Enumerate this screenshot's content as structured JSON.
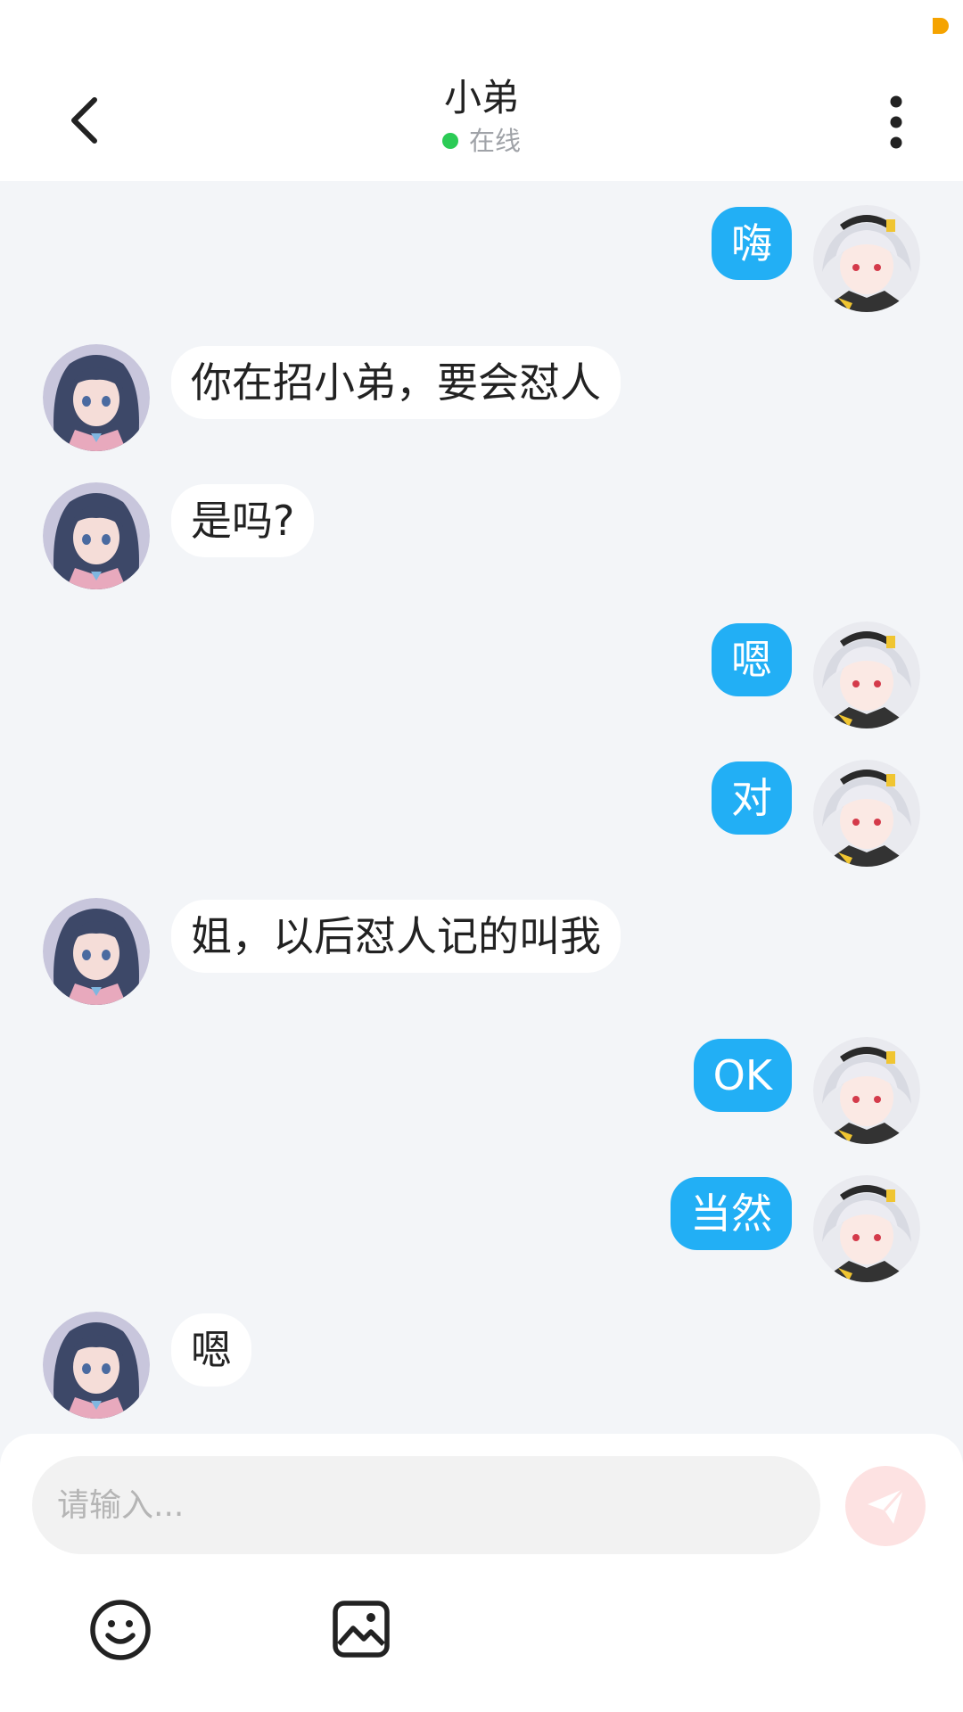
{
  "header": {
    "title": "小弟",
    "status": "在线",
    "status_color": "#2bcb55"
  },
  "icons": {
    "back": "chevron-left-icon",
    "more": "more-vertical-icon",
    "send": "send-icon",
    "emoji": "smiley-icon",
    "image": "image-icon"
  },
  "colors": {
    "sent_bubble": "#22aff5",
    "received_bubble": "#ffffff",
    "chat_background": "#f3f5f8",
    "status_indicator": "#f5a300"
  },
  "messages": [
    {
      "side": "right",
      "text": "嗨"
    },
    {
      "side": "left",
      "text": "你在招小弟，要会怼人"
    },
    {
      "side": "left",
      "text": "是吗?"
    },
    {
      "side": "right",
      "text": "嗯"
    },
    {
      "side": "right",
      "text": "对"
    },
    {
      "side": "left",
      "text": "姐，以后怼人记的叫我"
    },
    {
      "side": "right",
      "text": "OK"
    },
    {
      "side": "right",
      "text": "当然"
    },
    {
      "side": "left",
      "text": "嗯"
    }
  ],
  "composer": {
    "placeholder": "请输入...",
    "value": ""
  }
}
